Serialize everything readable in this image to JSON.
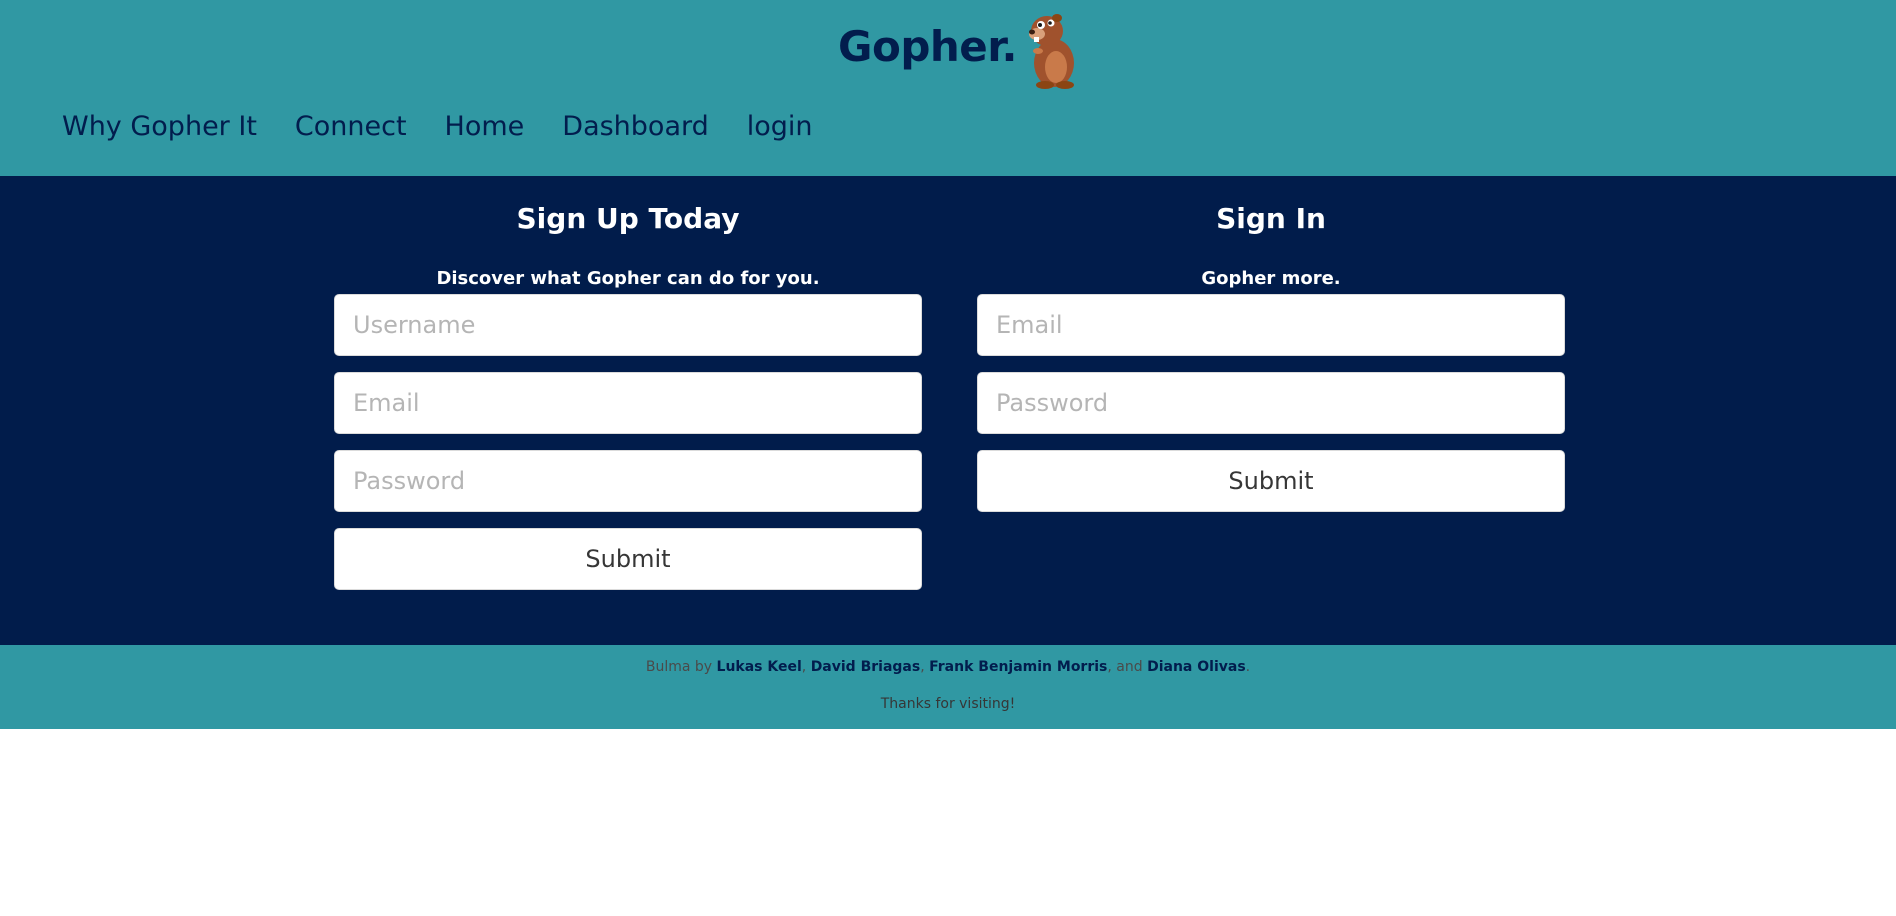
{
  "header": {
    "brand_title": "Gopher.",
    "logo_icon": "gopher-mascot-icon",
    "nav": [
      {
        "label": "Why Gopher It"
      },
      {
        "label": "Connect"
      },
      {
        "label": "Home"
      },
      {
        "label": "Dashboard"
      },
      {
        "label": "login"
      }
    ]
  },
  "signup": {
    "title": "Sign Up Today",
    "subtitle": "Discover what Gopher can do for you.",
    "username_placeholder": "Username",
    "email_placeholder": "Email",
    "password_placeholder": "Password",
    "submit_label": "Submit"
  },
  "signin": {
    "title": "Sign In",
    "subtitle": "Gopher more.",
    "email_placeholder": "Email",
    "password_placeholder": "Password",
    "submit_label": "Submit"
  },
  "footer": {
    "prefix": "Bulma by ",
    "authors": [
      "Lukas Keel",
      "David Briagas",
      "Frank Benjamin Morris",
      "Diana Olivas"
    ],
    "sep1": ", ",
    "sep2": ", ",
    "sep3": ", and ",
    "end": ".",
    "thanks": "Thanks for visiting!"
  },
  "colors": {
    "header_bg": "#3098a3",
    "main_bg": "#011c4b",
    "nav_text": "#021d4d"
  }
}
